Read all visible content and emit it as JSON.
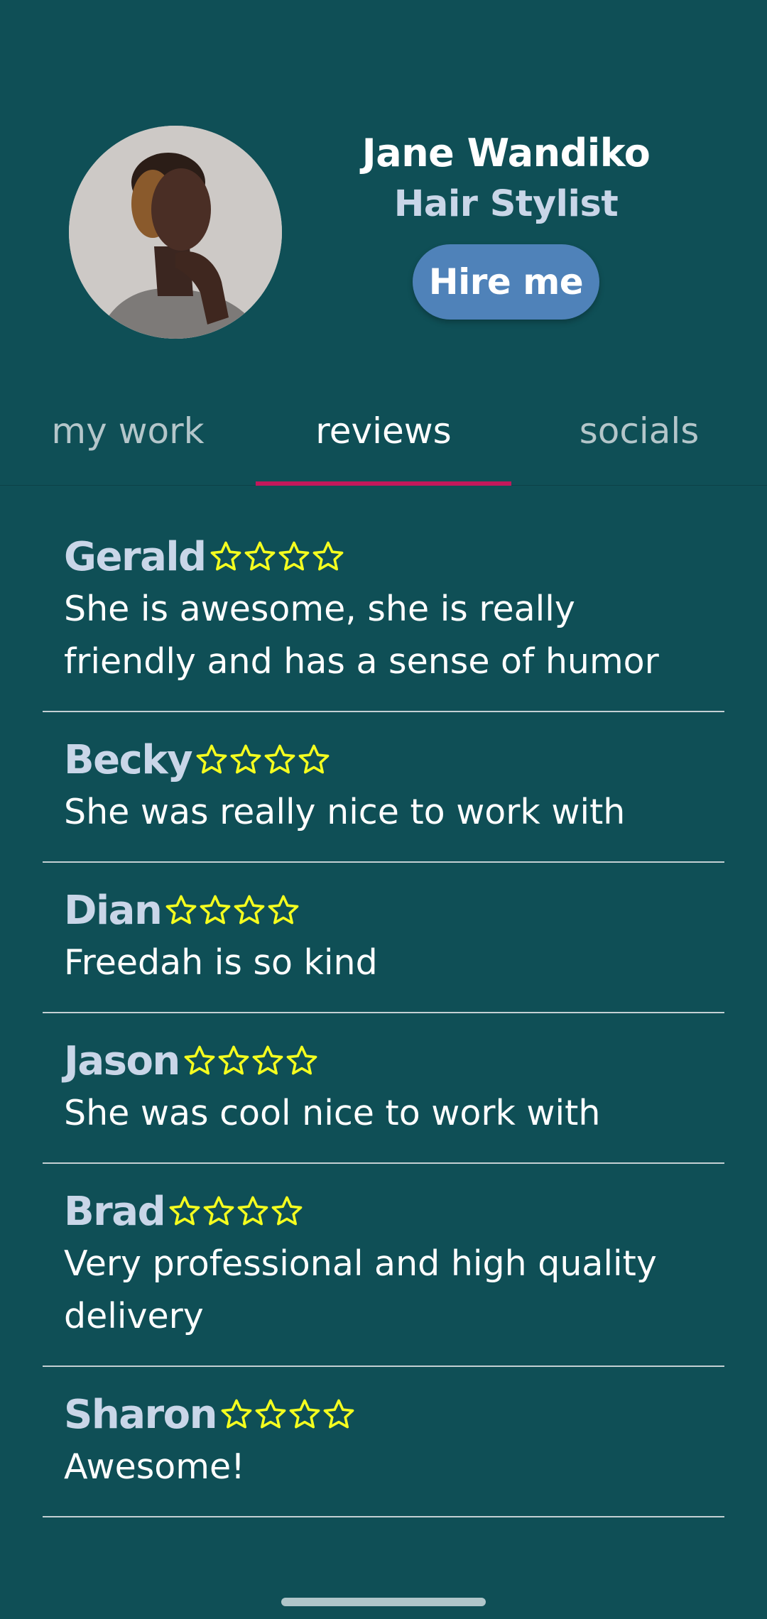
{
  "profile": {
    "name": "Jane Wandiko",
    "role": "Hair Stylist",
    "hire_label": "Hire me"
  },
  "tabs": [
    {
      "label": "my work",
      "active": false
    },
    {
      "label": "reviews",
      "active": true
    },
    {
      "label": "socials",
      "active": false
    }
  ],
  "reviews": [
    {
      "name": "Gerald",
      "stars": 4,
      "text": "She is awesome, she is really friendly and has a sense of humor"
    },
    {
      "name": "Becky",
      "stars": 4,
      "text": "She was really nice to work with"
    },
    {
      "name": "Dian",
      "stars": 4,
      "text": "Freedah is so kind"
    },
    {
      "name": "Jason",
      "stars": 4,
      "text": "She was cool nice to work with"
    },
    {
      "name": "Brad",
      "stars": 4,
      "text": "Very professional and high quality delivery"
    },
    {
      "name": "Sharon",
      "stars": 4,
      "text": "Awesome!"
    }
  ],
  "colors": {
    "background": "#0f4f56",
    "accent": "#c2185b",
    "button": "#4f82b9",
    "star": "#f5ff1f"
  },
  "icons": {
    "star": "star-outline-icon"
  }
}
